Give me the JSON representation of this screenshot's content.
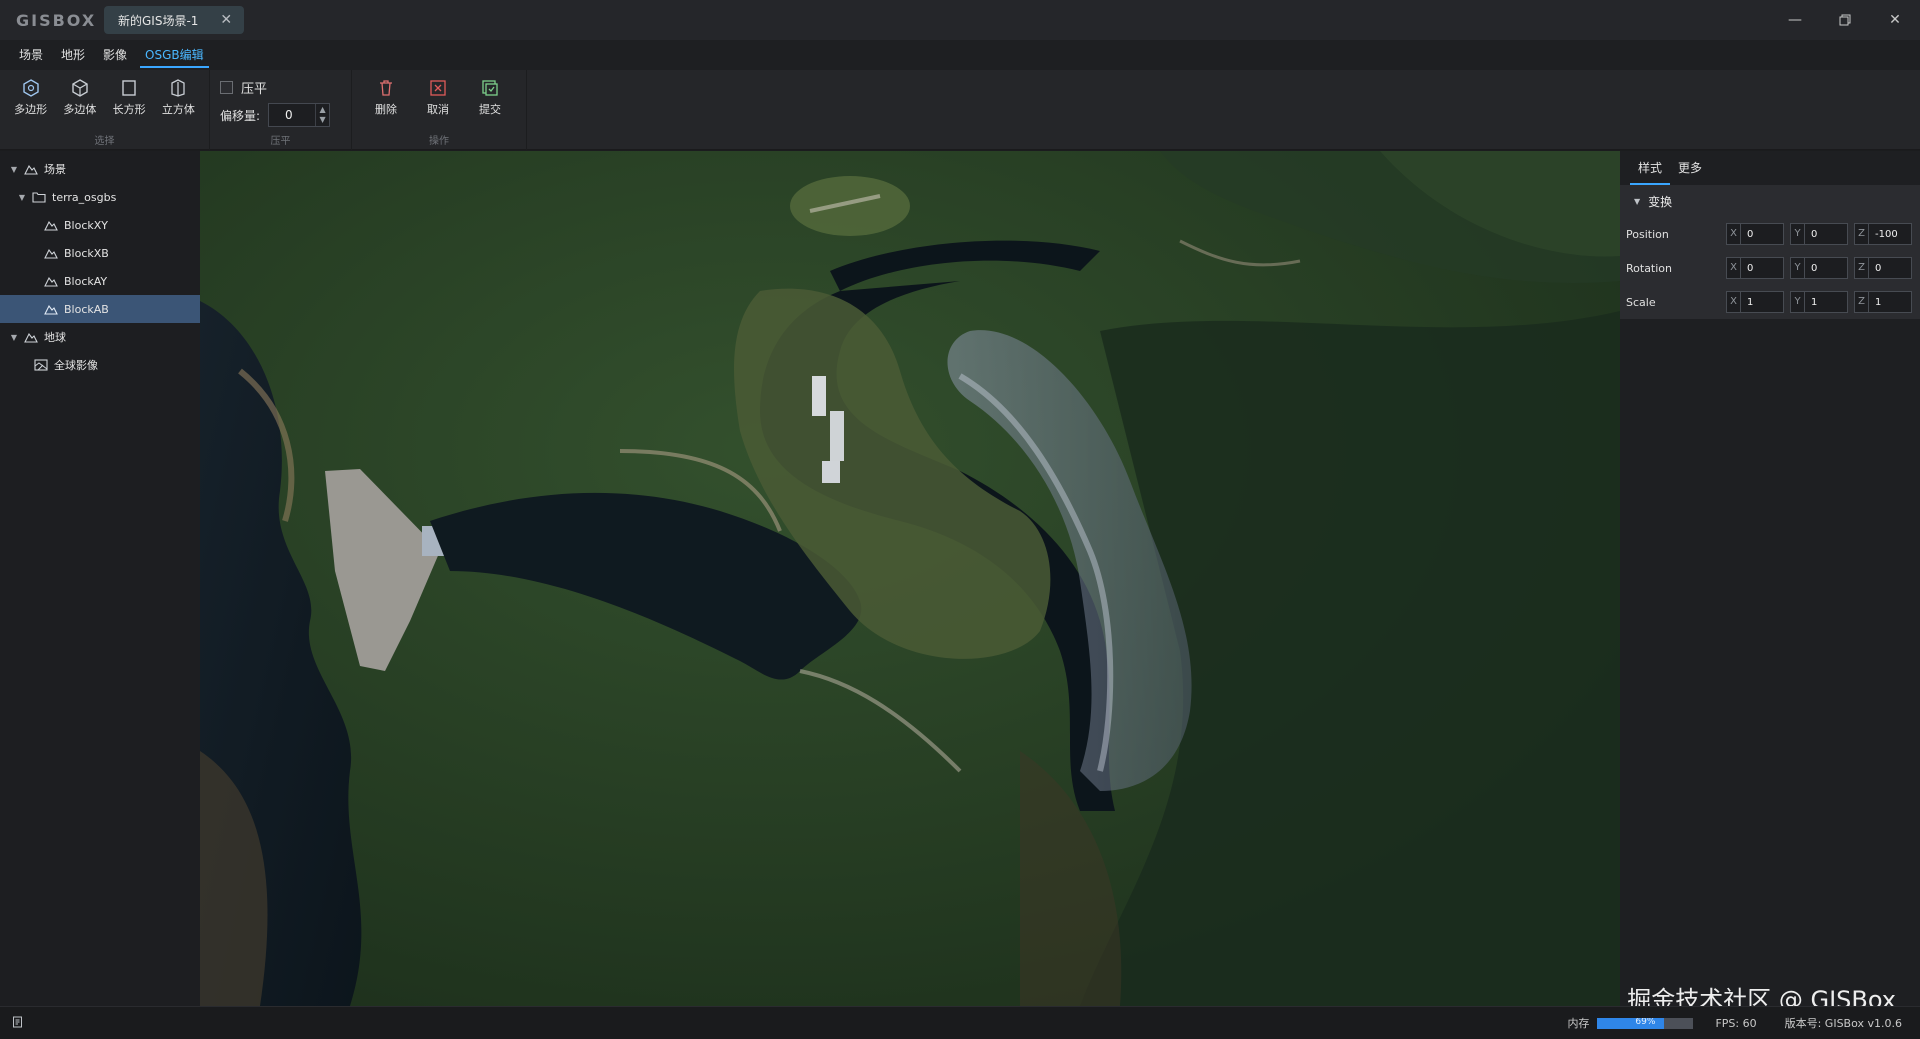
{
  "app": {
    "logo": "GISBOX"
  },
  "tab": {
    "title": "新的GIS场景-1"
  },
  "window_controls": [
    "minimize-icon",
    "restore-icon",
    "close-icon"
  ],
  "menu": {
    "items": [
      "场景",
      "地形",
      "影像",
      "OSGB编辑"
    ],
    "active": "OSGB编辑"
  },
  "ribbon": {
    "select": {
      "label": "选择",
      "buttons": [
        "多边形",
        "多边体",
        "长方形",
        "立方体"
      ]
    },
    "flatten": {
      "label": "压平",
      "checkbox_label": "压平",
      "offset_label": "偏移量:",
      "offset_value": "0"
    },
    "ops": {
      "label": "操作",
      "buttons": [
        "删除",
        "取消",
        "提交"
      ]
    }
  },
  "tree": {
    "items": [
      {
        "label": "场景",
        "level": 0,
        "expanded": true,
        "icon": "scene-icon"
      },
      {
        "label": "terra_osgbs",
        "level": 1,
        "expanded": true,
        "icon": "folder-icon"
      },
      {
        "label": "BlockXY",
        "level": 2,
        "icon": "model-icon"
      },
      {
        "label": "BlockXB",
        "level": 2,
        "icon": "model-icon"
      },
      {
        "label": "BlockAY",
        "level": 2,
        "icon": "model-icon"
      },
      {
        "label": "BlockAB",
        "level": 2,
        "icon": "model-icon",
        "selected": true
      },
      {
        "label": "地球",
        "level": 0,
        "expanded": true,
        "icon": "scene-icon"
      },
      {
        "label": "全球影像",
        "level": 1,
        "icon": "imagery-icon"
      }
    ]
  },
  "panel": {
    "tabs": [
      "样式",
      "更多"
    ],
    "section": "变换",
    "rows": [
      {
        "label": "Position",
        "x": "0",
        "y": "0",
        "z": "-100"
      },
      {
        "label": "Rotation",
        "x": "0",
        "y": "0",
        "z": "0"
      },
      {
        "label": "Scale",
        "x": "1",
        "y": "1",
        "z": "1"
      }
    ],
    "axes": [
      "X",
      "Y",
      "Z"
    ]
  },
  "watermark": "掘金技术社区 @ GISBox",
  "status": {
    "memory_label": "内存",
    "memory_percent": 69,
    "memory_text": "69%",
    "fps": "FPS: 60",
    "version": "版本号: GISBox v1.0.6"
  },
  "colors": {
    "accent": "#3aa6ff",
    "selected_row": "#3b5576",
    "memory_fill": "#2f86e8"
  }
}
